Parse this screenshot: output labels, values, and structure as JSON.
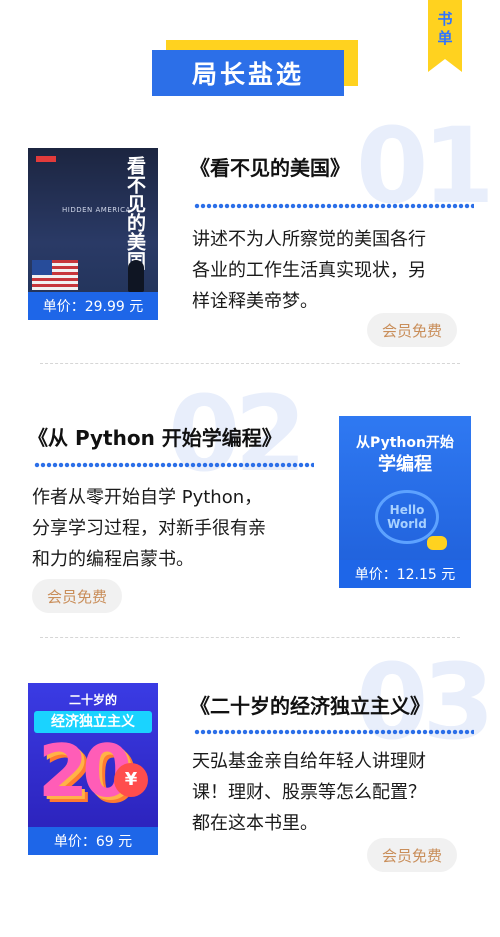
{
  "corner_tag": {
    "chars": [
      "书",
      "单"
    ]
  },
  "header": {
    "title": "局长盐选"
  },
  "books": [
    {
      "number": "01",
      "title": "《看不见的美国》",
      "description_lines": [
        "讲述不为人所察觉的美国各行",
        "各业的工作生活真实现状，另",
        "样诠释美帝梦。"
      ],
      "price": "单价：29.99  元",
      "badge": "会员免费",
      "cover": {
        "title": "看不见的美国",
        "subtitle": "HIDDEN AMERICA"
      }
    },
    {
      "number": "02",
      "title": "《从 Python 开始学编程》",
      "description_lines": [
        "作者从零开始自学 Python，",
        "分享学习过程，对新手很有亲",
        "和力的编程启蒙书。"
      ],
      "price": "单价：12.15 元",
      "badge": "会员免费",
      "cover": {
        "title_line1": "从Python开始",
        "title_line2": "学编程",
        "bubble_line1": "Hello",
        "bubble_line2": "World"
      }
    },
    {
      "number": "03",
      "title": "《二十岁的经济独立主义》",
      "description_lines": [
        "天弘基金亲自给年轻人讲理财",
        "课！理财、股票等怎么配置？",
        "都在这本书里。"
      ],
      "price": "单价：69 元",
      "badge": "会员免费",
      "cover": {
        "title_line1": "二十岁的",
        "title_line2": "经济独立主义",
        "big_text": "20",
        "coin": "¥"
      }
    }
  ],
  "colors": {
    "accent_blue": "#2c6fe8",
    "accent_yellow": "#ffd21f",
    "badge_text": "#c98e5a"
  }
}
